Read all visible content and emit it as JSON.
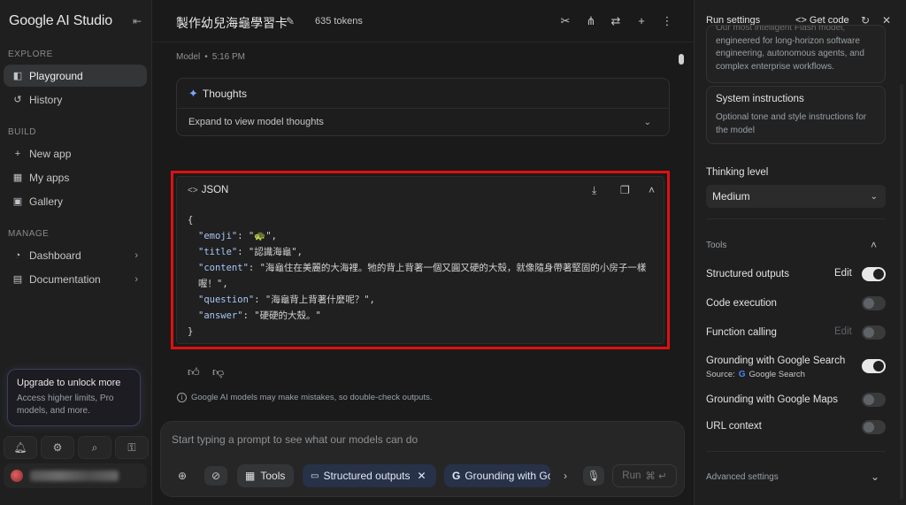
{
  "sidebar": {
    "logo": "Google AI Studio",
    "sections": {
      "explore": "EXPLORE",
      "build": "BUILD",
      "manage": "MANAGE"
    },
    "items": {
      "playground": "Playground",
      "history": "History",
      "new_app": "New app",
      "my_apps": "My apps",
      "gallery": "Gallery",
      "dashboard": "Dashboard",
      "documentation": "Documentation"
    },
    "upgrade": {
      "title": "Upgrade to unlock more",
      "subtitle": "Access higher limits, Pro models, and more."
    }
  },
  "main": {
    "title": "製作幼兒海龜學習卡",
    "tokens": "635 tokens",
    "meta": {
      "role": "Model",
      "time": "5:16 PM"
    },
    "thoughts": {
      "title": "Thoughts",
      "expand": "Expand to view model thoughts"
    },
    "json": {
      "label": "JSON",
      "open": "{",
      "close": "}",
      "lines": [
        {
          "key": "\"emoji\"",
          "value": "\"🐢\","
        },
        {
          "key": "\"title\"",
          "value": "\"認識海龜\","
        },
        {
          "key": "\"content\"",
          "value": "\"海龜住在美麗的大海裡。牠的背上背著一個又圓又硬的大殼，就像隨身帶著堅固的小房子一樣喔！\","
        },
        {
          "key": "\"question\"",
          "value": "\"海龜背上背著什麼呢？\","
        },
        {
          "key": "\"answer\"",
          "value": "\"硬硬的大殼。\""
        }
      ]
    },
    "disclaimer": "Google AI models may make mistakes, so double-check outputs.",
    "composer": {
      "placeholder": "Start typing a prompt to see what our models can do",
      "tools_label": "Tools",
      "structured_chip": "Structured outputs",
      "grounding_chip": "Grounding with Go",
      "run_label": "Run",
      "run_shortcut": "⌘ ↵"
    }
  },
  "right_panel": {
    "title": "Run settings",
    "get_code": "Get code",
    "model_desc_1": "Our most intelligent Flash model,",
    "model_desc_2": "engineered for long-horizon software engineering, autonomous agents, and complex enterprise workflows.",
    "system_instructions": {
      "title": "System instructions",
      "placeholder": "Optional tone and style instructions for the model"
    },
    "thinking_level": {
      "label": "Thinking level",
      "value": "Medium"
    },
    "tools": {
      "label": "Tools",
      "structured_outputs": "Structured outputs",
      "structured_edit": "Edit",
      "code_execution": "Code execution",
      "function_calling": "Function calling",
      "function_edit": "Edit",
      "grounding_search": "Grounding with Google Search",
      "source_label": "Source:",
      "source_value": "Google Search",
      "grounding_maps": "Grounding with Google Maps",
      "url_context": "URL context"
    },
    "advanced": "Advanced settings"
  },
  "toggles": {
    "structured_outputs": true,
    "code_execution": false,
    "function_calling": false,
    "grounding_search": true,
    "grounding_maps": false,
    "url_context": false
  },
  "colors": {
    "highlight_border": "#e01010",
    "accent_blue": "#7aa7ff",
    "json_key": "#a8c7fa"
  }
}
